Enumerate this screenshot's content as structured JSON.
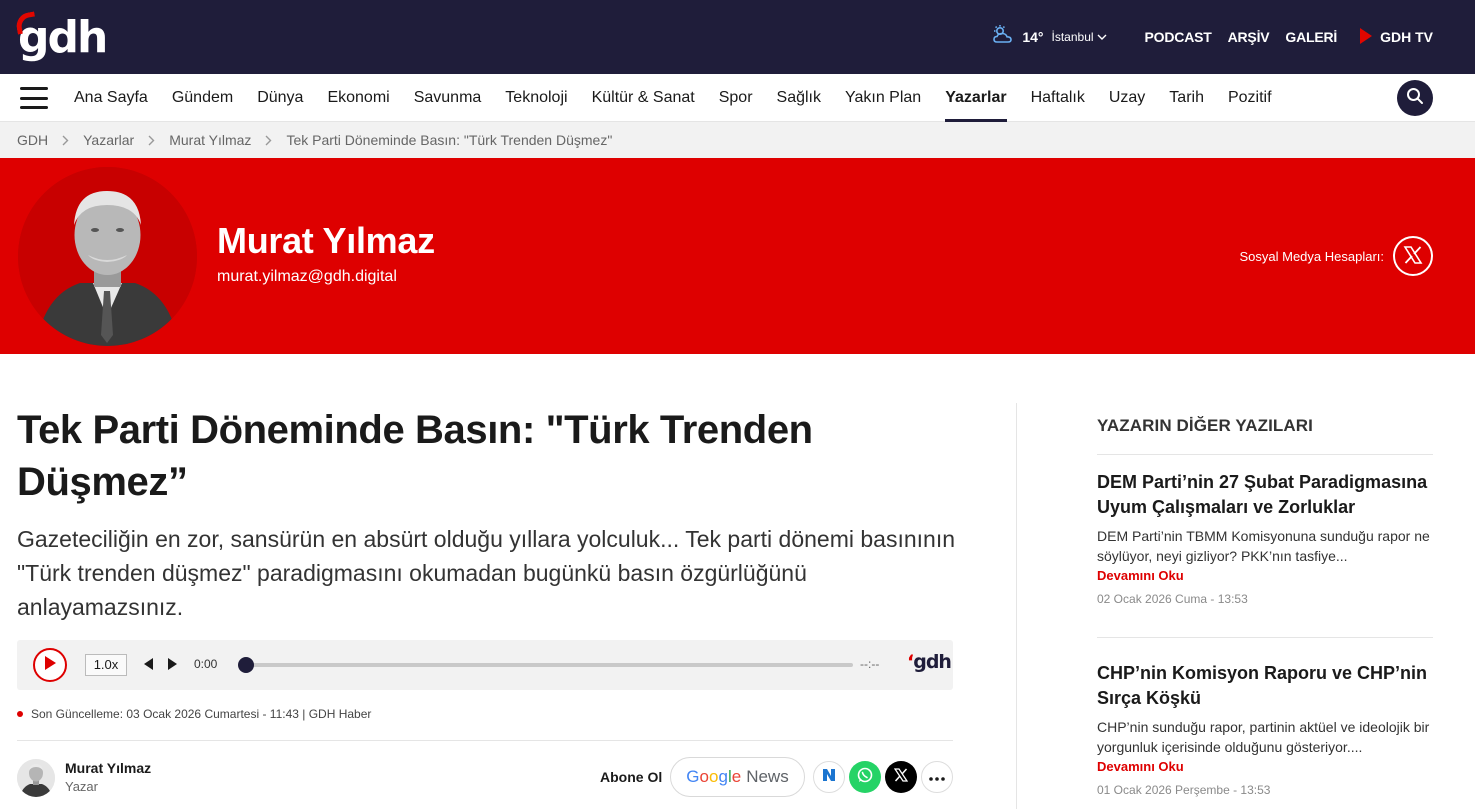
{
  "site": {
    "logo": "gdh"
  },
  "header": {
    "weather": {
      "temp": "14°",
      "city": "İstanbul"
    },
    "links": [
      "PODCAST",
      "ARŞİV",
      "GALERİ"
    ],
    "tv_label": "GDH TV",
    "colors": {
      "bg": "#1f1d3a",
      "accent": "#e10600"
    }
  },
  "nav": {
    "items": [
      "Ana Sayfa",
      "Gündem",
      "Dünya",
      "Ekonomi",
      "Savunma",
      "Teknoloji",
      "Kültür & Sanat",
      "Spor",
      "Sağlık",
      "Yakın Plan",
      "Yazarlar",
      "Haftalık",
      "Uzay",
      "Tarih",
      "Pozitif"
    ],
    "active": "Yazarlar"
  },
  "breadcrumb": [
    "GDH",
    "Yazarlar",
    "Murat Yılmaz",
    "Tek Parti Döneminde Basın: \"Türk Trenden Düşmez\""
  ],
  "author_hero": {
    "name": "Murat Yılmaz",
    "email": "murat.yilmaz@gdh.digital",
    "social_label": "Sosyal Medya Hesapları:",
    "bg_color": "#de0000"
  },
  "article": {
    "title": "Tek Parti Döneminde Basın: \"Türk Trenden Düşmez”",
    "lead": "Gazeteciliğin en zor, sansürün en absürt olduğu yıllara yolculuk... Tek parti dönemi basınının \"Türk trenden düşmez\" paradigmasını okumadan bugünkü basın özgürlüğünü anlayamazsınız.",
    "player": {
      "speed": "1.0x",
      "current_time": "0:00",
      "total_time": "--:--",
      "progress": 0,
      "logo": "gdh"
    },
    "updated": "Son Güncelleme: 03 Ocak 2026 Cumartesi - 11:43 | GDH Haber",
    "author": {
      "name": "Murat Yılmaz",
      "role": "Yazar"
    },
    "subscribe_label": "Abone Ol",
    "google_news": {
      "google": "Google",
      "news": "News"
    },
    "share_icons": [
      "n-icon",
      "whatsapp-icon",
      "x-icon",
      "more-icon"
    ]
  },
  "sidebar": {
    "heading": "YAZARIN DİĞER YAZILARI",
    "posts": [
      {
        "title": "DEM Parti’nin 27 Şubat Paradigmasına Uyum Çalışmaları ve Zorluklar",
        "excerpt": "DEM Parti’nin TBMM Komisyonuna sunduğu rapor ne söylüyor, neyi gizliyor? PKK’nın tasfiye...",
        "more": "Devamını Oku",
        "date": "02 Ocak 2026 Cuma - 13:53"
      },
      {
        "title": "CHP’nin Komisyon Raporu ve CHP’nin Sırça Köşkü",
        "excerpt": "CHP’nin sunduğu rapor, partinin aktüel ve ideolojik bir yorgunluk içerisinde olduğunu gösteriyor....",
        "more": "Devamını Oku",
        "date": "01 Ocak 2026 Perşembe - 13:53"
      }
    ]
  }
}
